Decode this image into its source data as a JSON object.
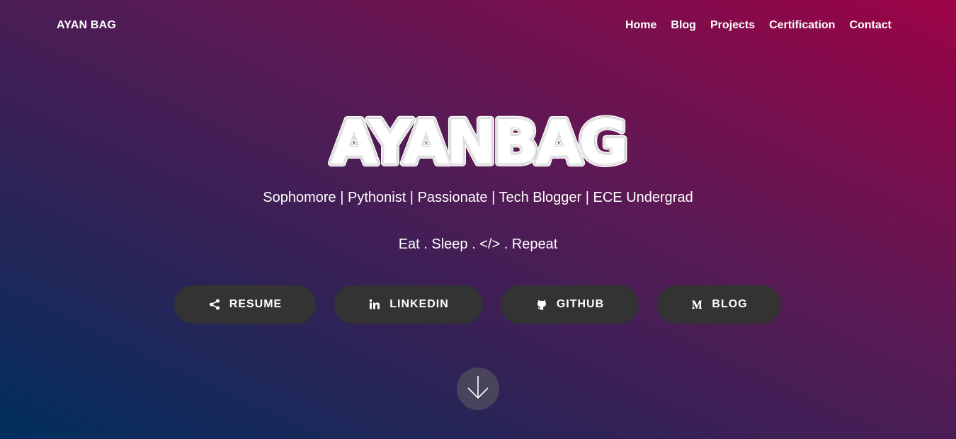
{
  "nav": {
    "brand": "AYAN BAG",
    "links": [
      {
        "label": "Home"
      },
      {
        "label": "Blog"
      },
      {
        "label": "Projects"
      },
      {
        "label": "Certification"
      },
      {
        "label": "Contact"
      }
    ]
  },
  "hero": {
    "title": "AYANBAG",
    "tagline": "Sophomore | Pythonist | Passionate | Tech Blogger | ECE Undergrad",
    "motto": "Eat . Sleep . </> . Repeat"
  },
  "buttons": [
    {
      "label": "RESUME",
      "icon": "share-icon"
    },
    {
      "label": "LINKEDIN",
      "icon": "linkedin-icon"
    },
    {
      "label": "GITHUB",
      "icon": "github-icon"
    },
    {
      "label": "BLOG",
      "icon": "medium-icon"
    }
  ],
  "scroll": {
    "icon": "arrow-down-icon"
  },
  "colors": {
    "gradient_start": "#002f5e",
    "gradient_mid": "#5a1a55",
    "gradient_end": "#9c0346",
    "button_bg": "#333333",
    "text": "#ffffff"
  }
}
